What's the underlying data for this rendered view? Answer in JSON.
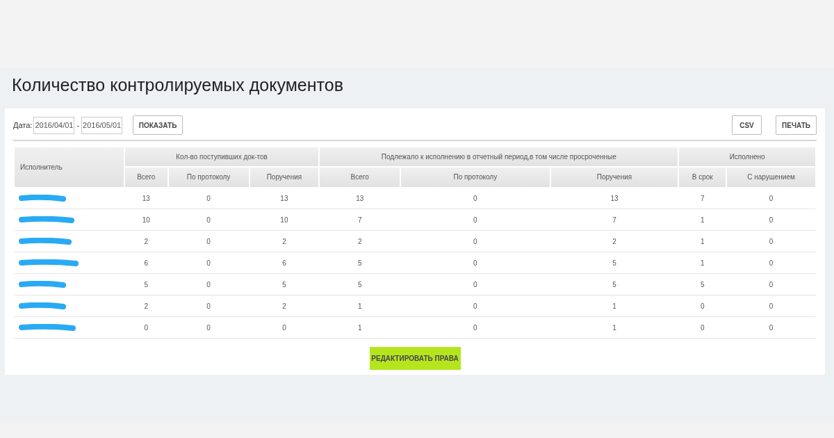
{
  "title": "Количество контролируемых документов",
  "filter": {
    "label": "Дата:",
    "date_from": "2016/04/01",
    "separator": "-",
    "date_to": "2016/05/01",
    "show_button": "ПОКАЗАТЬ"
  },
  "export_buttons": [
    "CSV",
    "ПЕЧАТЬ"
  ],
  "table": {
    "first_column": "Исполнитель",
    "groups": [
      {
        "label": "Кол-во поступивших док-тов",
        "columns": [
          "Всего",
          "По протоколу",
          "Поручения"
        ]
      },
      {
        "label": "Подлежало к исполнению в отчетный период,в том числе просроченные",
        "columns": [
          "Всего",
          "По протоколу",
          "Поручения"
        ]
      },
      {
        "label": "Исполнено",
        "columns": [
          "В срок",
          "С нарушением"
        ]
      }
    ],
    "rows": [
      {
        "values": [
          "13",
          "0",
          "13",
          "13",
          "0",
          "13",
          "7",
          "0"
        ]
      },
      {
        "values": [
          "10",
          "0",
          "10",
          "7",
          "0",
          "7",
          "1",
          "0"
        ]
      },
      {
        "values": [
          "2",
          "0",
          "2",
          "2",
          "0",
          "2",
          "1",
          "0"
        ]
      },
      {
        "values": [
          "6",
          "0",
          "6",
          "5",
          "0",
          "5",
          "1",
          "0"
        ]
      },
      {
        "values": [
          "5",
          "0",
          "5",
          "5",
          "0",
          "5",
          "5",
          "0"
        ]
      },
      {
        "values": [
          "2",
          "0",
          "2",
          "1",
          "0",
          "1",
          "0",
          "0"
        ]
      },
      {
        "values": [
          "0",
          "0",
          "0",
          "1",
          "0",
          "1",
          "0",
          "0"
        ]
      }
    ]
  },
  "edit_button": "РЕДАКТИРОВАТЬ ПРАВА"
}
